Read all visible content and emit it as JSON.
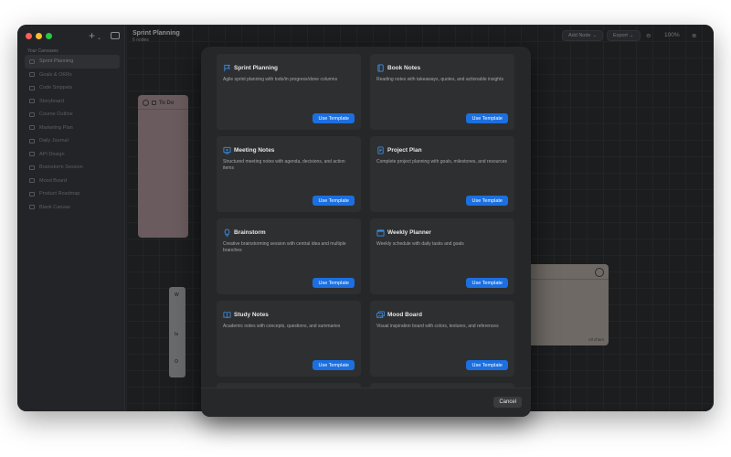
{
  "sidebar": {
    "section_label": "Your Canvases",
    "items": [
      {
        "label": "Sprint Planning"
      },
      {
        "label": "Goals & OKRs"
      },
      {
        "label": "Code Snippets"
      },
      {
        "label": "Storyboard"
      },
      {
        "label": "Course Outline"
      },
      {
        "label": "Marketing Plan"
      },
      {
        "label": "Daily Journal"
      },
      {
        "label": "API Design"
      },
      {
        "label": "Brainstorm Session"
      },
      {
        "label": "Mood Board"
      },
      {
        "label": "Product Roadmap"
      },
      {
        "label": "Blank Canvas"
      }
    ],
    "add_label": "+",
    "add_caret": "⌄"
  },
  "document": {
    "title": "Sprint Planning",
    "subtitle": "6 nodes"
  },
  "toolbar": {
    "add_node_label": "Add Node",
    "export_label": "Export",
    "zoom_out": "⊖",
    "zoom_level": "100%",
    "zoom_in": "⊕",
    "caret": "⌄"
  },
  "nodes": {
    "todo_title": "To Do",
    "right_footer": "All chars",
    "left_letters": [
      "W",
      "Is",
      "O"
    ]
  },
  "template_modal": {
    "templates": [
      {
        "title": "Sprint Planning",
        "description": "Agile sprint planning with todo/in progress/done columns",
        "icon": "flag-icon",
        "button": "Use Template"
      },
      {
        "title": "Book Notes",
        "description": "Reading notes with takeaways, quotes, and actionable insights",
        "icon": "book-icon",
        "button": "Use Template"
      },
      {
        "title": "Meeting Notes",
        "description": "Structured meeting notes with agenda, decisions, and action items",
        "icon": "meeting-icon",
        "button": "Use Template"
      },
      {
        "title": "Project Plan",
        "description": "Complete project planning with goals, milestones, and resources",
        "icon": "document-icon",
        "button": "Use Template"
      },
      {
        "title": "Brainstorm",
        "description": "Creative brainstorming session with central idea and multiple branches",
        "icon": "lightbulb-icon",
        "button": "Use Template"
      },
      {
        "title": "Weekly Planner",
        "description": "Weekly schedule with daily tasks and goals",
        "icon": "calendar-icon",
        "button": "Use Template"
      },
      {
        "title": "Study Notes",
        "description": "Academic notes with concepts, questions, and summaries",
        "icon": "open-book-icon",
        "button": "Use Template"
      },
      {
        "title": "Mood Board",
        "description": "Visual inspiration board with colors, textures, and references",
        "icon": "images-icon",
        "button": "Use Template"
      }
    ],
    "cancel_label": "Cancel"
  },
  "colors": {
    "accent": "#1b6fe0",
    "icon_blue": "#3a8ee6",
    "modal_bg": "#262729",
    "card_bg": "#2e2f31"
  }
}
